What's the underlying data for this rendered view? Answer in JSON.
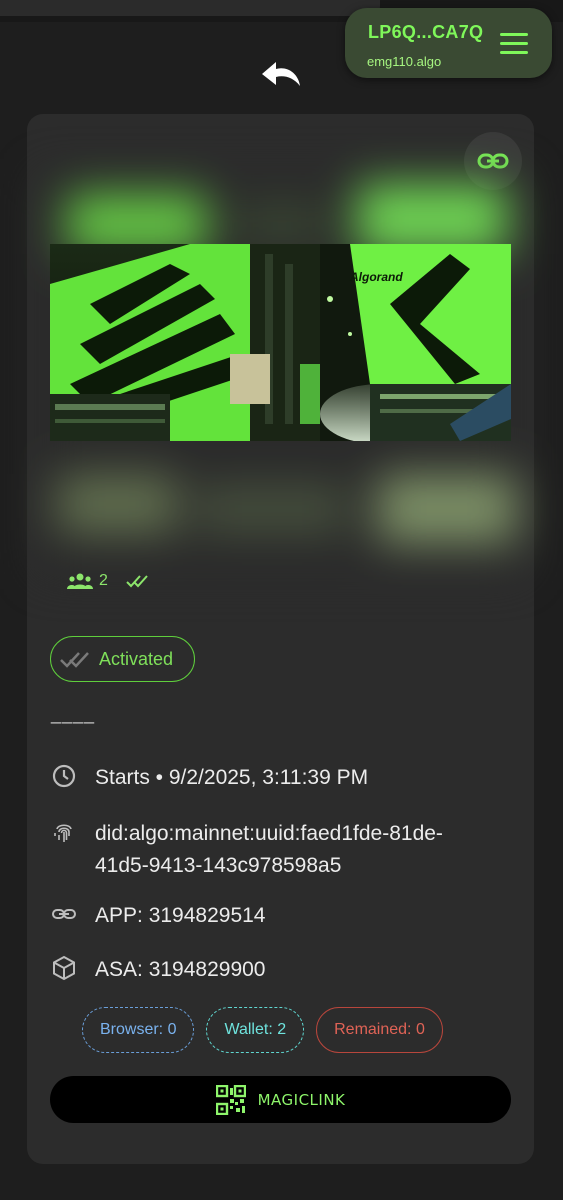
{
  "header": {
    "wallet_address": "LP6Q...CA7Q",
    "wallet_name": "emg110.algo",
    "menu_icon": "hamburger-menu-icon",
    "back_icon": "undo-arrow-icon"
  },
  "card": {
    "link_icon": "chain-link-icon",
    "banner_text": "Algorand",
    "stats": {
      "participants": "2",
      "participants_icon": "group-icon",
      "status_icon": "double-check-icon"
    },
    "status": {
      "label": "Activated",
      "icon": "double-check-icon"
    },
    "divider": "____",
    "info": {
      "start_label": "Starts • 9/2/2025, 3:11:39 PM",
      "did_line1": "did:algo:mainnet:uuid:faed1fde-81de-",
      "did_line2": "41d5-9413-143c978598a5",
      "app": "APP: 3194829514",
      "asa": "ASA: 3194829900"
    },
    "chips": {
      "browser": "Browser: 0",
      "wallet": "Wallet: 2",
      "remained": "Remained: 0"
    },
    "magic_button": "MAGICLINK"
  },
  "colors": {
    "accent_green": "#7ff75a",
    "background": "#1e1e1e",
    "card": "#2c2c2c",
    "browser_chip": "#7ab2ee",
    "wallet_chip": "#6fe4de",
    "remained_chip": "#e06356"
  }
}
